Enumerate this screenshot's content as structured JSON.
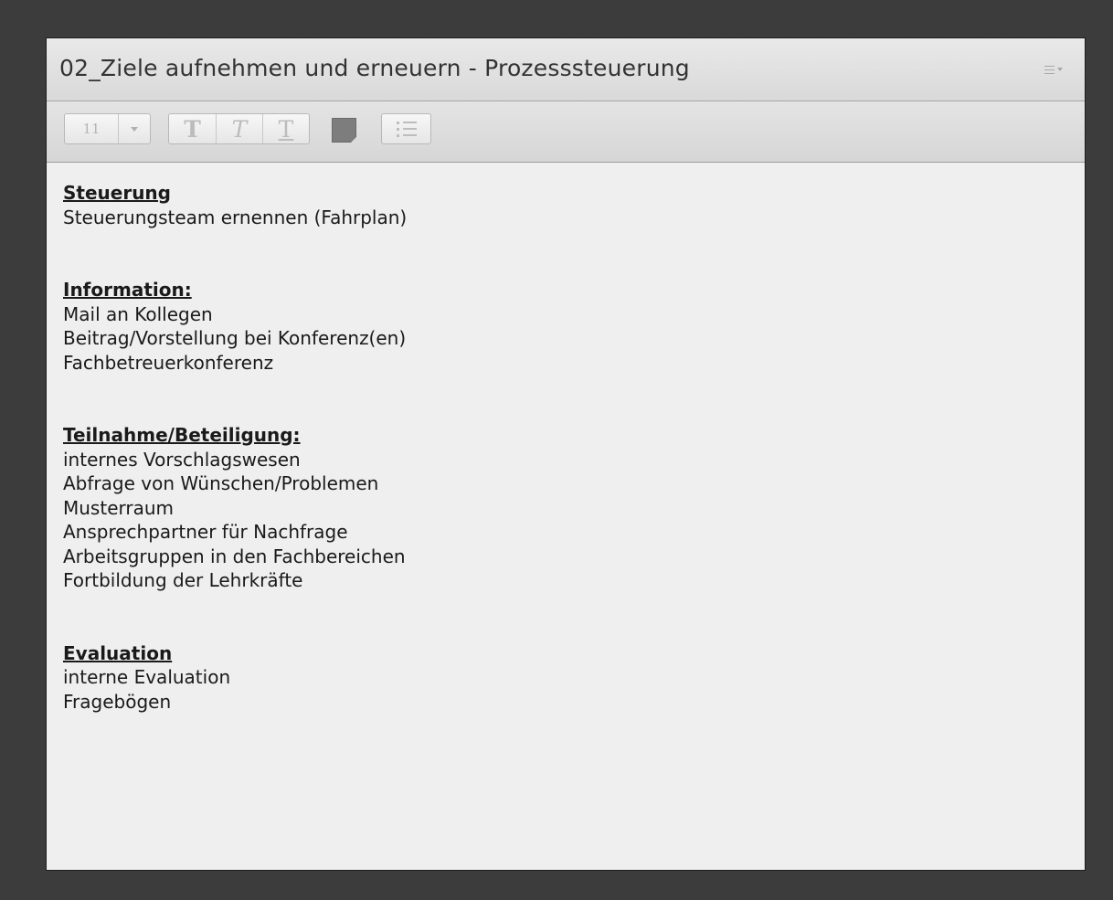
{
  "pod": {
    "title": "02_Ziele aufnehmen und erneuern - Prozesssteuerung",
    "menu_icon": "pod-options-menu-icon"
  },
  "toolbar": {
    "font_size": "11",
    "bold_label": "T",
    "italic_label": "T",
    "underline_label": "T",
    "text_color": "#7d7d7d",
    "list_icon": "bullet-list-icon"
  },
  "notes": {
    "sections": [
      {
        "heading": "Steuerung",
        "lines": [
          "Steuerungsteam ernennen (Fahrplan)"
        ]
      },
      {
        "heading": "Information:",
        "lines": [
          "Mail an Kollegen",
          "Beitrag/Vorstellung bei Konferenz(en)",
          "Fachbetreuerkonferenz"
        ]
      },
      {
        "heading": "Teilnahme/Beteiligung:",
        "lines": [
          "internes Vorschlagswesen",
          "Abfrage von Wünschen/Problemen",
          "Musterraum",
          "Ansprechpartner für Nachfrage",
          "Arbeitsgruppen in den Fachbereichen",
          "Fortbildung der Lehrkräfte"
        ]
      },
      {
        "heading": "Evaluation",
        "lines": [
          "interne Evaluation",
          "Fragebögen"
        ]
      }
    ]
  }
}
